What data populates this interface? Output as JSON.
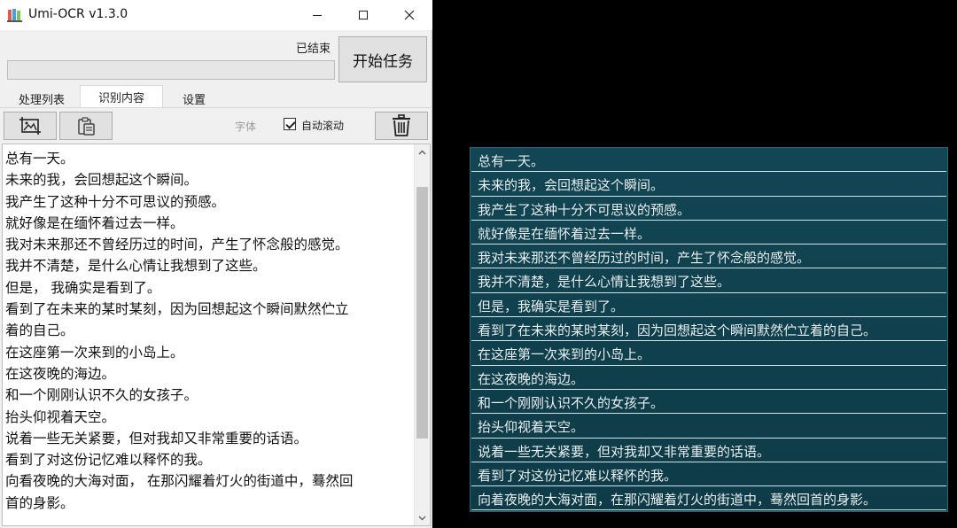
{
  "window": {
    "title": "Umi-OCR v1.3.0",
    "status": "已结束",
    "progress": 0,
    "start_button": "开始任务",
    "tabs": [
      {
        "label": "处理列表"
      },
      {
        "label": "识别内容"
      },
      {
        "label": "设置"
      }
    ],
    "toolbar": {
      "font_label": "字体",
      "autoscroll_label": "自动滚动",
      "autoscroll_checked": true
    },
    "text_lines": [
      "总有一天。",
      "未来的我，会回想起这个瞬间。",
      "我产生了这种十分不可思议的预感。",
      "就好像是在缅怀着过去一样。",
      "我对未来那还不曾经历过的时间，产生了怀念般的感觉。",
      "我并不清楚，是什么心情让我想到了这些。",
      "但是， 我确实是看到了。",
      "看到了在未来的某时某刻，因为回想起这个瞬间默然伫立",
      "着的自己。",
      "在这座第一次来到的小岛上。",
      "在这夜晚的海边。",
      "和一个刚刚认识不久的女孩子。",
      "抬头仰视着天空。",
      "说着一些无关紧要，但对我却又非常重要的话语。",
      "看到了对这份记忆难以释怀的我。",
      "向看夜晚的大海对面， 在那闪耀着灯火的街道中，蓦然回",
      "首的身影。"
    ]
  },
  "game_panel": {
    "lines": [
      "总有一天。",
      "未来的我，会回想起这个瞬间。",
      "我产生了这种十分不可思议的预感。",
      "就好像是在缅怀着过去一样。",
      "我对未来那还不曾经历过的时间，产生了怀念般的感觉。",
      "我并不清楚，是什么心情让我想到了这些。",
      "但是，我确实是看到了。",
      "看到了在未来的某时某刻，因为回想起这个瞬间默然伫立着的自己。",
      "在这座第一次来到的小岛上。",
      "在这夜晚的海边。",
      "和一个刚刚认识不久的女孩子。",
      "抬头仰视着天空。",
      "说着一些无关紧要，但对我却又非常重要的话语。",
      "看到了对这份记忆难以释怀的我。",
      "向着夜晚的大海对面，在那闪耀着灯火的街道中，蓦然回首的身影。"
    ]
  },
  "colors": {
    "panel_bg": "#124654",
    "panel_line": "#cfe4ea",
    "window_bg": "#f0f0f0"
  }
}
